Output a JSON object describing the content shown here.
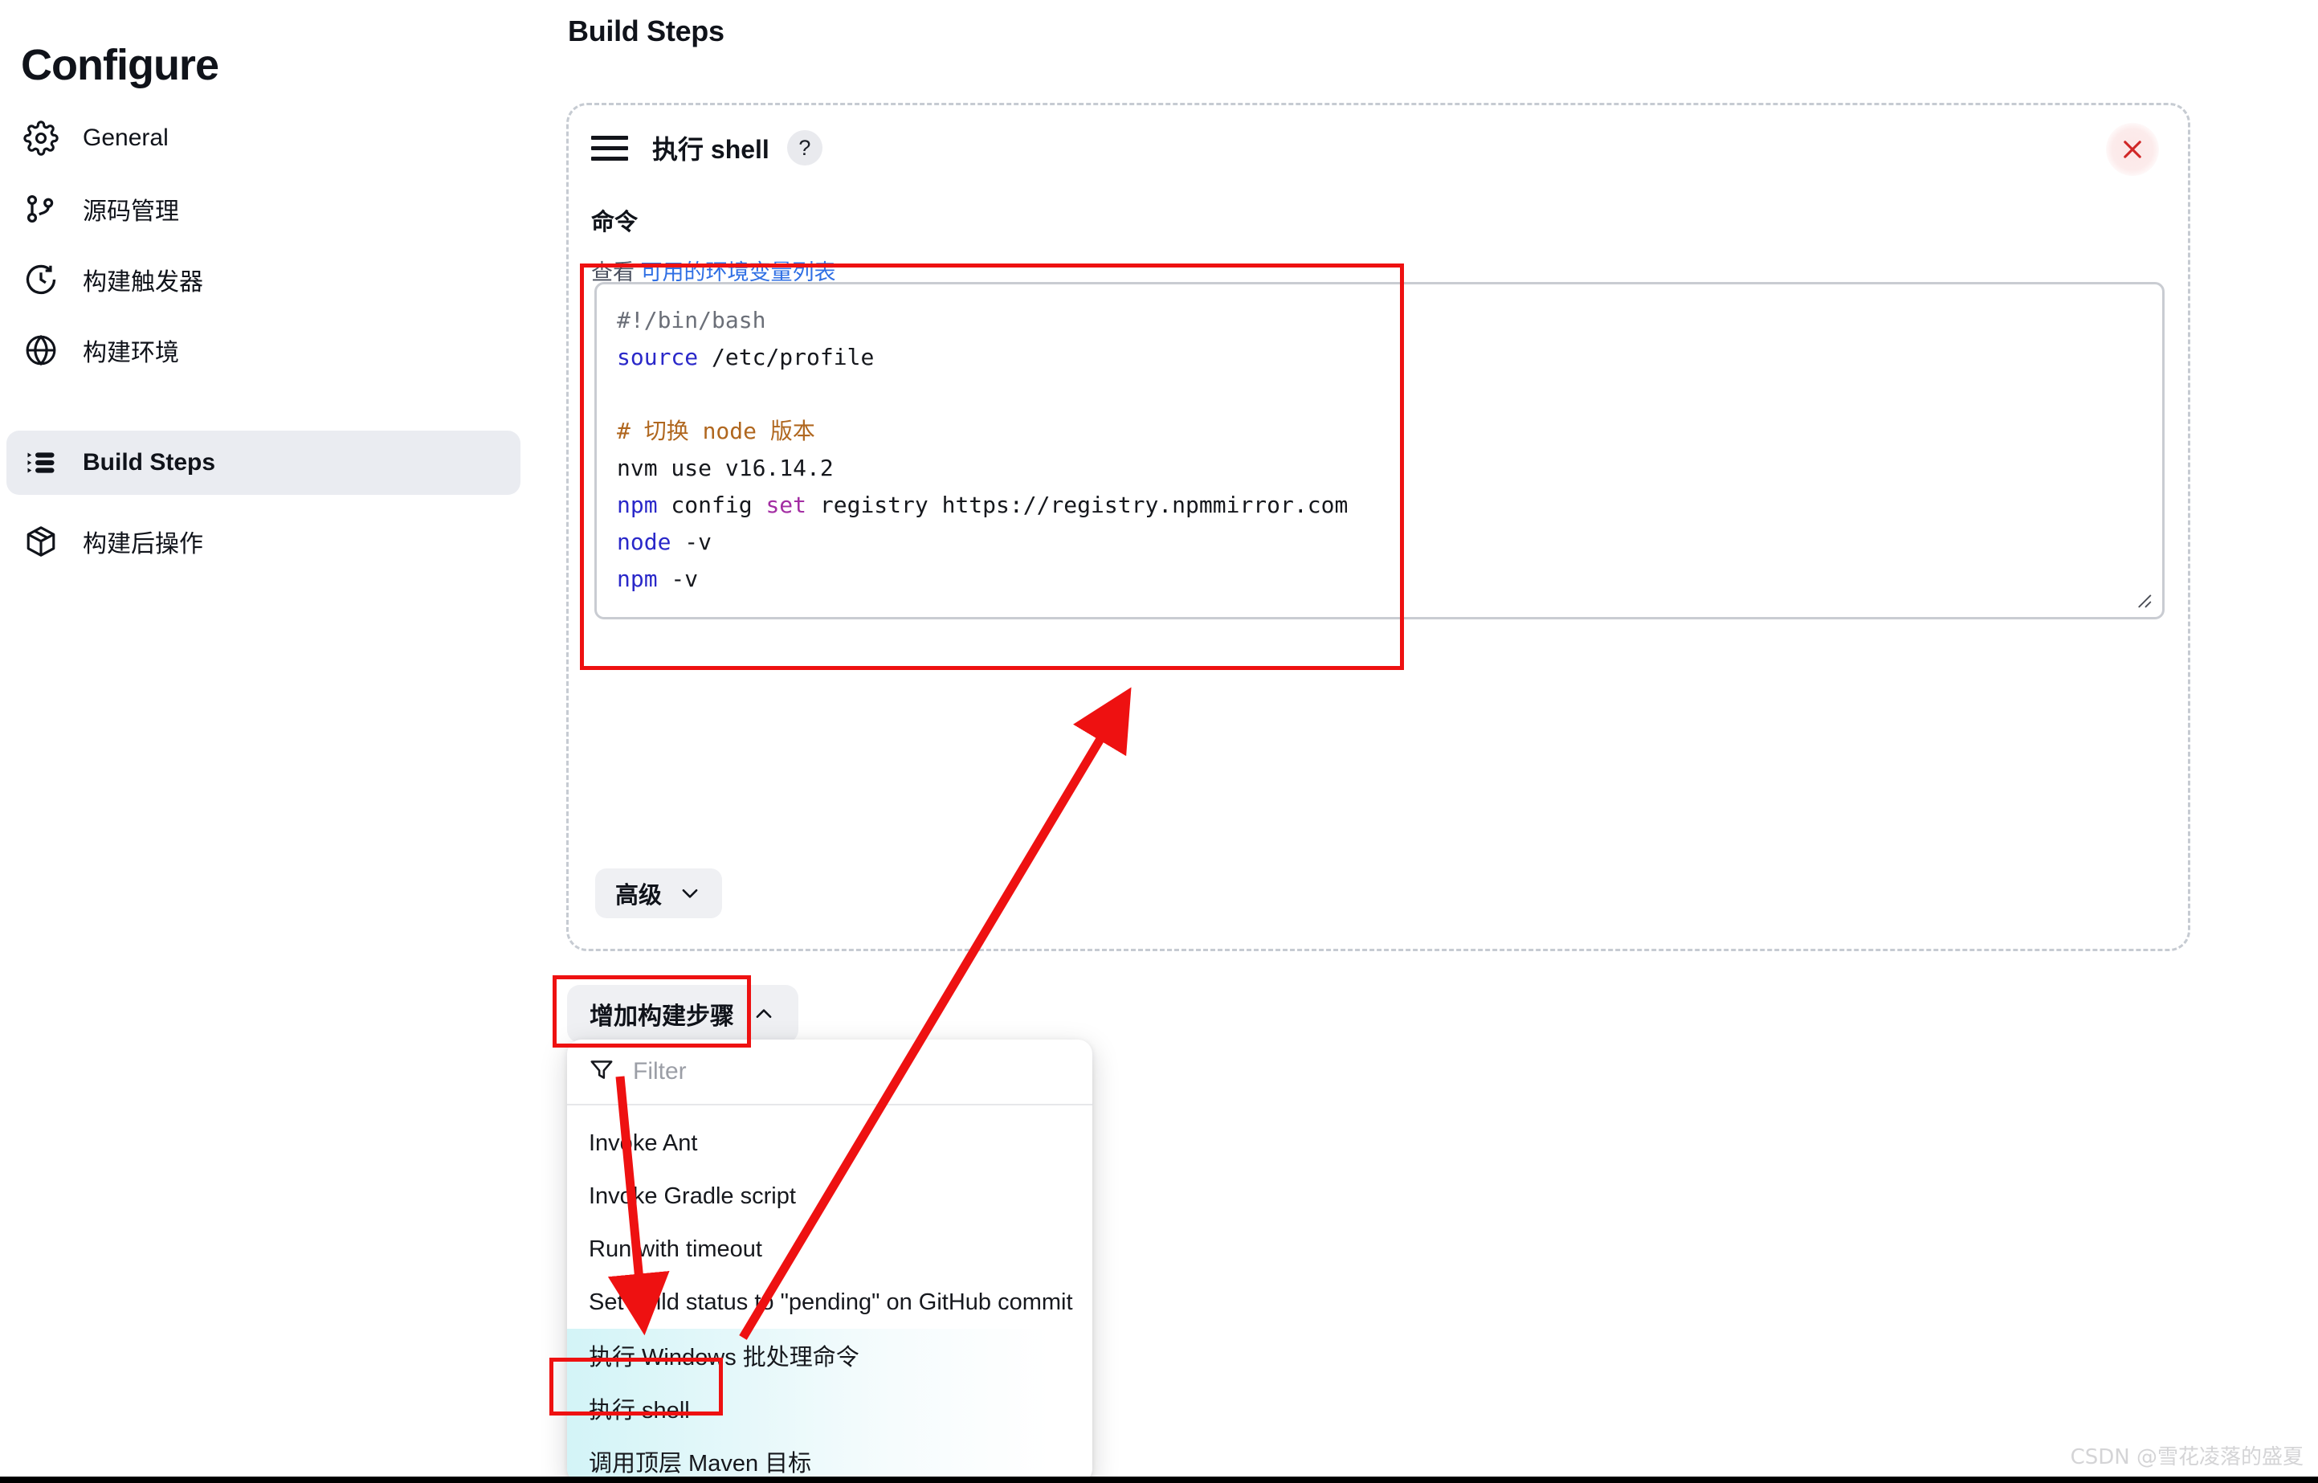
{
  "sidebar": {
    "title": "Configure",
    "items": [
      {
        "label": "General",
        "icon": "gear-icon",
        "active": false
      },
      {
        "label": "源码管理",
        "icon": "git-branch-icon",
        "active": false
      },
      {
        "label": "构建触发器",
        "icon": "clock-icon",
        "active": false
      },
      {
        "label": "构建环境",
        "icon": "globe-icon",
        "active": false
      },
      {
        "label": "Build Steps",
        "icon": "steps-list-icon",
        "active": true
      },
      {
        "label": "构建后操作",
        "icon": "package-icon",
        "active": false
      }
    ]
  },
  "main": {
    "page_title": "Build Steps"
  },
  "step_card": {
    "drag_handle_icon": "drag-handle-icon",
    "title": "执行 shell",
    "help_label": "?",
    "close_icon": "close-icon",
    "command_label": "命令",
    "env_prefix": "查看 ",
    "env_link": "可用的环境变量列表",
    "advanced_label": "高级",
    "advanced_chevron": "chevron-down-icon"
  },
  "command": {
    "lines": [
      [
        {
          "t": "#!/bin/bash",
          "c": "c-gray"
        }
      ],
      [
        {
          "t": "source",
          "c": "c-blue"
        },
        {
          "t": " /etc/profile",
          "c": "c-black"
        }
      ],
      [
        {
          "t": "",
          "c": "c-black"
        }
      ],
      [
        {
          "t": "# 切换 node 版本",
          "c": "c-orange"
        }
      ],
      [
        {
          "t": "nvm use v16.14.2",
          "c": "c-black"
        }
      ],
      [
        {
          "t": "npm",
          "c": "c-blue"
        },
        {
          "t": " config ",
          "c": "c-black"
        },
        {
          "t": "set",
          "c": "c-purple"
        },
        {
          "t": " registry https://registry.npmmirror.com",
          "c": "c-black"
        }
      ],
      [
        {
          "t": "node",
          "c": "c-blue"
        },
        {
          "t": " -v",
          "c": "c-black"
        }
      ],
      [
        {
          "t": "npm",
          "c": "c-blue"
        },
        {
          "t": " -v",
          "c": "c-black"
        }
      ]
    ]
  },
  "add_step": {
    "label": "增加构建步骤",
    "chevron": "chevron-up-icon"
  },
  "dropdown": {
    "filter_icon": "filter-icon",
    "filter_placeholder": "Filter",
    "items": [
      {
        "label": "Invoke Ant",
        "highlighted": false
      },
      {
        "label": "Invoke Gradle script",
        "highlighted": false
      },
      {
        "label": "Run with timeout",
        "highlighted": false
      },
      {
        "label": "Set build status to \"pending\" on GitHub commit",
        "highlighted": false
      },
      {
        "label": "执行 Windows 批处理命令",
        "highlighted": true
      },
      {
        "label": "执行 shell",
        "highlighted": true
      },
      {
        "label": "调用顶层 Maven 目标",
        "highlighted": true
      }
    ]
  },
  "annotations": {
    "accent_color": "#ee1111",
    "boxes": [
      "command-textarea-region",
      "add-build-step-button",
      "execute-shell-menu-item"
    ],
    "arrows": [
      "menu-item-execute-windows-batch-to-command-textarea",
      "filter-to-execute-windows-batch-item"
    ]
  },
  "watermark": {
    "text": "CSDN @雪花凌落的盛夏"
  }
}
